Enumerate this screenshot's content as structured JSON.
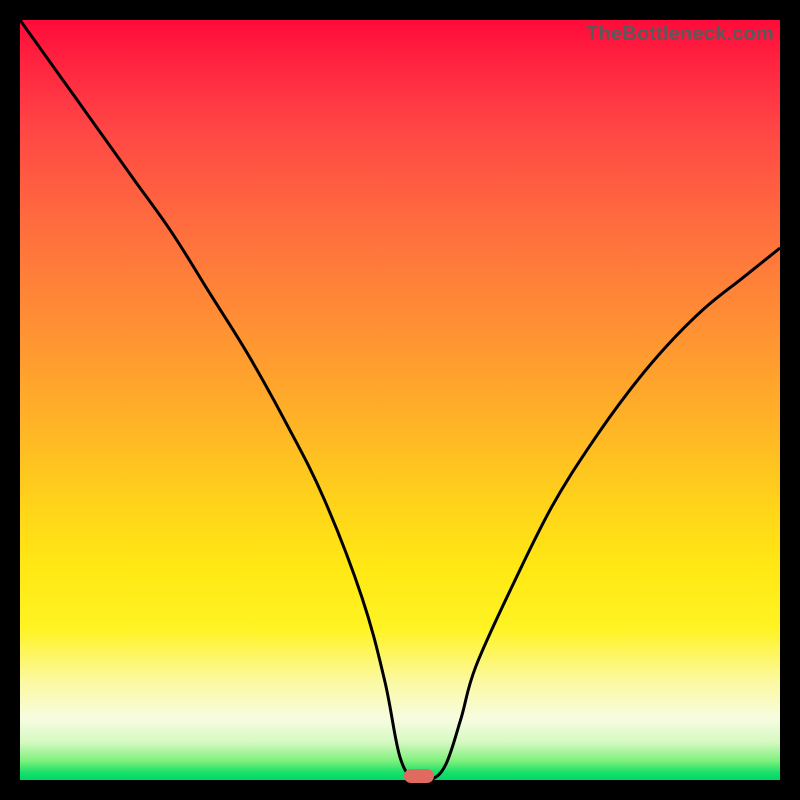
{
  "watermark": "TheBottleneck.com",
  "chart_data": {
    "type": "line",
    "title": "",
    "xlabel": "",
    "ylabel": "",
    "xlim": [
      0,
      100
    ],
    "ylim": [
      0,
      100
    ],
    "grid": false,
    "legend": false,
    "series": [
      {
        "name": "curve",
        "x": [
          0,
          5,
          10,
          15,
          20,
          25,
          30,
          35,
          40,
          45,
          48,
          50,
          52,
          54,
          56,
          58,
          60,
          65,
          70,
          75,
          80,
          85,
          90,
          95,
          100
        ],
        "values": [
          100,
          93,
          86,
          79,
          72,
          64,
          56,
          47,
          37,
          24,
          13,
          3,
          0,
          0,
          2,
          8,
          15,
          26,
          36,
          44,
          51,
          57,
          62,
          66,
          70
        ]
      }
    ],
    "annotations": [
      {
        "name": "optimal-marker",
        "x": 52.5,
        "y": 0,
        "shape": "pill",
        "color": "#e16a60"
      }
    ]
  },
  "colors": {
    "curve_stroke": "#000000",
    "marker_fill": "#e16a60",
    "frame": "#000000"
  }
}
